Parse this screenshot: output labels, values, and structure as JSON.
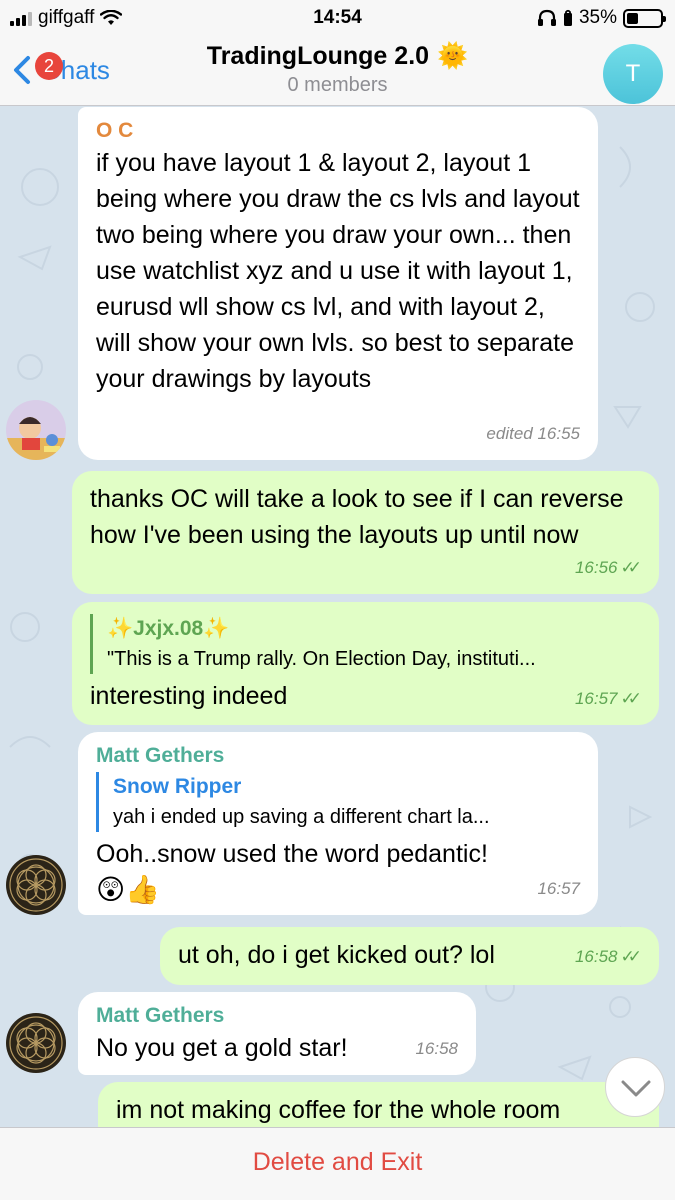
{
  "status_bar": {
    "carrier": "giffgaff",
    "time": "14:54",
    "battery": "35%",
    "battery_level": 0.35
  },
  "header": {
    "back_label": "Chats",
    "unread_count": "2",
    "title": "TradingLounge 2.0",
    "subtitle": "0 members",
    "avatar_letter": "T",
    "title_emoji": "🌞"
  },
  "messages": [
    {
      "direction": "in",
      "sender": "O C",
      "text": "if you have layout 1 & layout 2, layout 1 being where you draw the cs lvls and layout two being where you draw your own... then use watchlist xyz and u use it with layout 1, eurusd wll show cs lvl, and with layout 2, will show your own lvls. so best to separate your drawings by layouts",
      "time": "edited 16:55"
    },
    {
      "direction": "out",
      "text": "thanks OC will take a look to see if I can reverse how I've been using the layouts up until now",
      "time": "16:56"
    },
    {
      "direction": "out",
      "reply_name": "✨Jxjx.08✨",
      "reply_text": "\"This is a Trump rally. On Election Day, instituti...",
      "text": "interesting indeed",
      "time": "16:57"
    },
    {
      "direction": "in",
      "sender": "Matt Gethers",
      "reply_name": "Snow Ripper",
      "reply_text": "yah i ended up saving a different chart la...",
      "text": "Ooh..snow used the word pedantic!",
      "emoji": "😲👍",
      "time": "16:57"
    },
    {
      "direction": "out",
      "text": "ut oh, do i get kicked out? lol",
      "time": "16:58"
    },
    {
      "direction": "in",
      "sender": "Matt Gethers",
      "text": "No you get a gold star!",
      "time": "16:58"
    },
    {
      "direction": "out",
      "text": "im not making coffee for the whole room"
    }
  ],
  "footer": {
    "action_label": "Delete and Exit"
  },
  "colors": {
    "accent": "#2d88e3",
    "outgoing_bubble": "#e1fec6",
    "incoming_bubble": "#ffffff",
    "sender_oc": "#e3893d",
    "sender_matt": "#4fae98",
    "danger": "#e14b42"
  }
}
